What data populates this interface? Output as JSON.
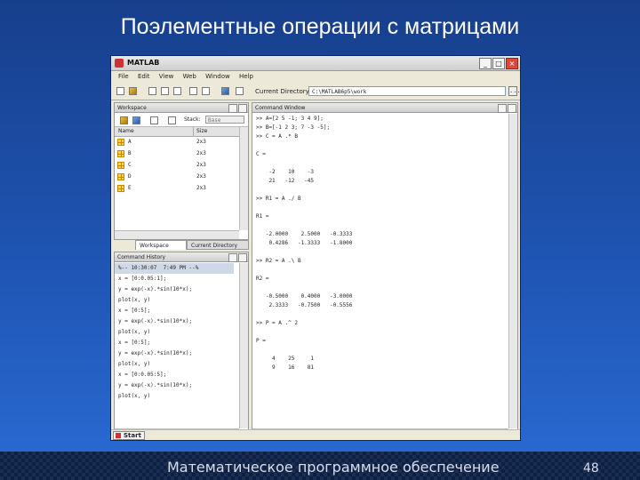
{
  "slide": {
    "title": "Поэлементные операции с матрицами",
    "footer": "Математическое программное обеспечение",
    "page_number": "48"
  },
  "window": {
    "title": "MATLAB",
    "controls": [
      "_",
      "□",
      "×"
    ],
    "menu": [
      "File",
      "Edit",
      "View",
      "Web",
      "Window",
      "Help"
    ],
    "current_directory_label": "Current Directory:",
    "current_directory_value": "C:\\MATLAB6p5\\work",
    "browse_label": "..."
  },
  "workspace": {
    "title": "Workspace",
    "stack_label": "Stack:",
    "stack_value": "Base",
    "columns": [
      "Name",
      "Size"
    ],
    "rows": [
      {
        "name": "A",
        "size": "2x3"
      },
      {
        "name": "B",
        "size": "2x3"
      },
      {
        "name": "C",
        "size": "2x3"
      },
      {
        "name": "D",
        "size": "2x3"
      },
      {
        "name": "E",
        "size": "2x3"
      }
    ],
    "tabs": [
      "Workspace",
      "Current Directory"
    ]
  },
  "history": {
    "title": "Command History",
    "lines": [
      "%-- 10:30:07  7:49 PM --%",
      "x = [0:0.05:1];",
      "y = exp(-x).*sin(10*x);",
      "plot(x, y)",
      "x = [0:5];",
      "y = exp(-x).*sin(10*x);",
      "plot(x, y)",
      "x = [0:5];",
      "y = exp(-x).*sin(10*x);",
      "plot(x, y)",
      "x = [0:0.05:5];",
      "y = exp(-x).*sin(10*x);",
      "plot(x, y)"
    ]
  },
  "command_window": {
    "title": "Command Window",
    "lines": [
      ">> A=[2 5 -1; 3 4 9];",
      ">> B=[-1 2 3; 7 -3 -5];",
      ">> C = A .* B",
      "",
      "C =",
      "",
      "    -2    10    -3",
      "    21   -12   -45",
      "",
      ">> R1 = A ./ B",
      "",
      "R1 =",
      "",
      "   -2.0000    2.5000   -0.3333",
      "    0.4286   -1.3333   -1.8000",
      "",
      ">> R2 = A .\\ B",
      "",
      "R2 =",
      "",
      "   -0.5000    0.4000   -3.0000",
      "    2.3333   -0.7500   -0.5556",
      "",
      ">> P = A .^ 2",
      "",
      "P =",
      "",
      "     4    25     1",
      "     9    16    81"
    ]
  },
  "start_label": "Start"
}
